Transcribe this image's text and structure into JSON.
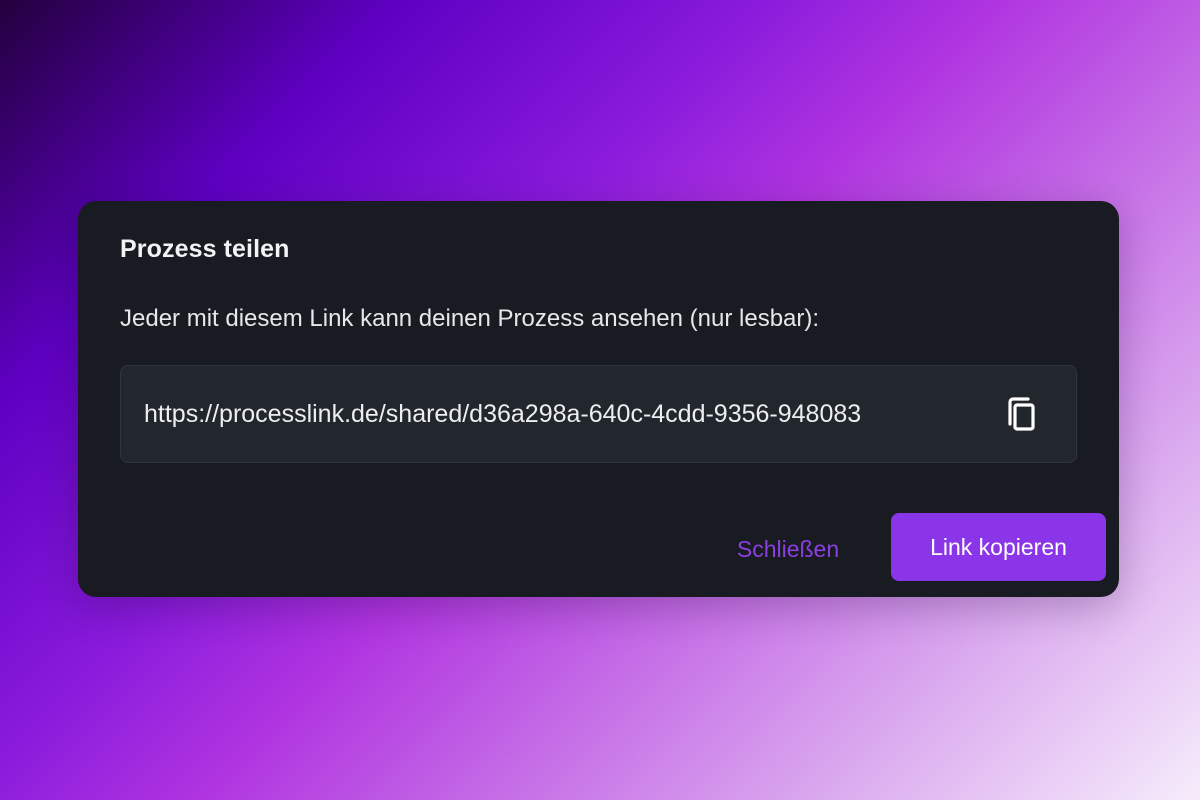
{
  "dialog": {
    "title": "Prozess teilen",
    "description": "Jeder mit diesem Link kann deinen Prozess ansehen (nur lesbar):",
    "share_link": "https://processlink.de/shared/d36a298a-640c-4cdd-9356-948083",
    "copy_icon": "copy-icon",
    "close_label": "Schließen",
    "copy_link_label": "Link kopieren"
  },
  "colors": {
    "dialog_background": "#181b21",
    "link_box_background": "#22262d",
    "accent": "#8a36e8",
    "close_text": "#8b3fe0"
  }
}
